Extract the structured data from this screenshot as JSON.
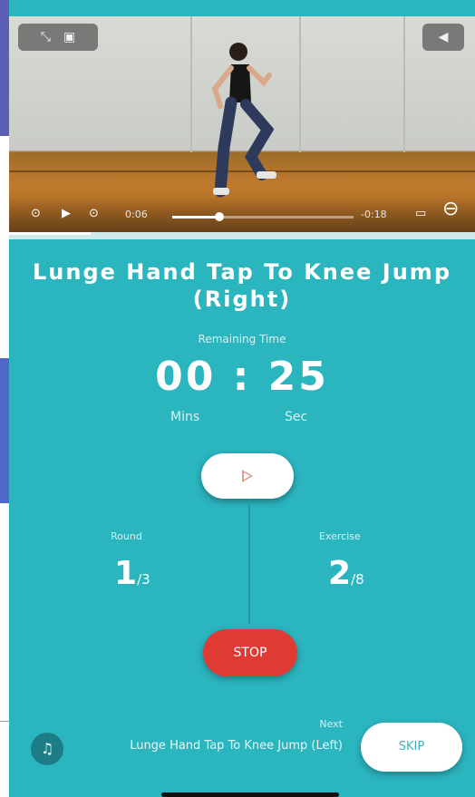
{
  "video": {
    "time_current": "0:06",
    "time_remaining": "-0:18",
    "progress": 0.26,
    "icons": [
      "collapse-icon",
      "lock-icon",
      "volume-icon",
      "replay-icon",
      "play-icon",
      "skip-icon",
      "airplay-icon",
      "rotate-icon"
    ]
  },
  "exercise": {
    "title": "Lunge Hand Tap To Knee Jump (Right)",
    "remaining_label": "Remaining Time",
    "minutes": "00",
    "separator": ":",
    "seconds": "25",
    "minutes_label": "Mins",
    "seconds_label": "Sec"
  },
  "stats": {
    "round_label": "Round",
    "round_value": "1",
    "round_total": "/3",
    "exercise_label": "Exercise",
    "exercise_value": "2",
    "exercise_total": "/8"
  },
  "controls": {
    "stop_label": "STOP",
    "skip_label": "SKIP",
    "music_icon": "music-note-icon"
  },
  "next": {
    "label": "Next",
    "name": "Lunge Hand Tap To Knee Jump (Left)"
  },
  "colors": {
    "background": "#2bb5bf",
    "stop": "#e03a35",
    "accent": "#ffffff"
  }
}
